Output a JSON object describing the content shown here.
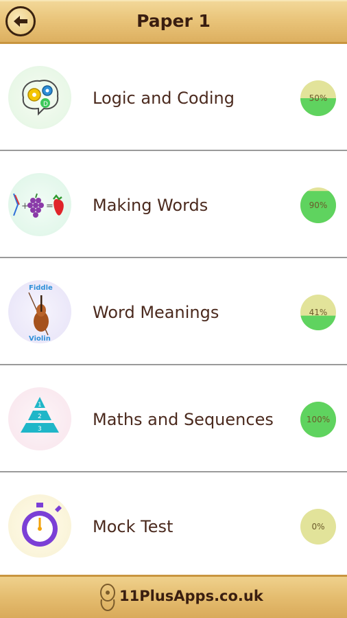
{
  "header": {
    "title": "Paper 1"
  },
  "items": [
    {
      "label": "Logic and Coding",
      "progress_text": "50%",
      "progress": 0.5,
      "icon": "brain-gears-icon",
      "icon_bg": "#eaf8ea"
    },
    {
      "label": "Making Words",
      "progress_text": "90%",
      "progress": 0.9,
      "icon": "word-puzzle-icon",
      "icon_bg": "#e6f8ef"
    },
    {
      "label": "Word Meanings",
      "progress_text": "41%",
      "progress": 0.41,
      "icon": "violin-icon",
      "icon_bg": "#ece8f8",
      "icon_top": "Fiddle",
      "icon_bottom": "Violin"
    },
    {
      "label": "Maths and Sequences",
      "progress_text": "100%",
      "progress": 1.0,
      "icon": "pyramid-icon",
      "icon_bg": "#fbeef3"
    },
    {
      "label": "Mock Test",
      "progress_text": "0%",
      "progress": 0.0,
      "icon": "stopwatch-icon",
      "icon_bg": "#fbf6e0"
    }
  ],
  "footer": {
    "text": "11PlusApps.co.uk"
  },
  "colors": {
    "progress_fill": "#5fd35f",
    "progress_track": "#e2e39a",
    "text": "#4b2a1e"
  }
}
